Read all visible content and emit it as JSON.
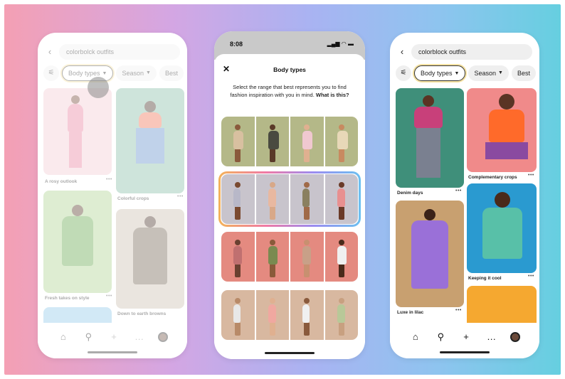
{
  "colors": {
    "bg_left": "#f4a0b4",
    "bg_right": "#66cfe0",
    "chip_glow": "#f3e0a0"
  },
  "left_phone": {
    "search": "colorbolck outfits",
    "chips": [
      "Body types",
      "Season",
      "Best"
    ],
    "captions": [
      "A rosy outlook",
      "Colorful crops",
      "Fresh takes on style",
      "Down to earth browns"
    ],
    "tabs": [
      "home-icon",
      "search-icon",
      "plus-icon",
      "chat-icon",
      "avatar"
    ]
  },
  "middle_phone": {
    "time": "8:08",
    "status_icons": "▂▄▆ ◠ ▬",
    "title": "Body types",
    "prompt_a": "Select the range that best represents you to find fashion inspiration with you in mind.",
    "prompt_link": "What is this?",
    "rows": [
      {
        "bg": "#b4b888",
        "skin": [
          "#8a5a3c",
          "#5a3a28",
          "#e0b090",
          "#c88a60"
        ],
        "cloth": [
          "#d8c0a0",
          "#4a4a40",
          "#f0c8d0",
          "#e8d8b8"
        ]
      },
      {
        "bg": "#c8c4cc",
        "skin": [
          "#7a4a30",
          "#d8a888",
          "#a06a48",
          "#6a3a28"
        ],
        "cloth": [
          "#b8b8c8",
          "#e8b8a0",
          "#8a8060",
          "#e89090"
        ]
      },
      {
        "bg": "#e48a80",
        "skin": [
          "#6a4030",
          "#8a5a3a",
          "#c89070",
          "#4a2a1a"
        ],
        "cloth": [
          "#c07070",
          "#7a8a50",
          "#c8a088",
          "#f0f0f0"
        ]
      },
      {
        "bg": "#d8b8a0",
        "skin": [
          "#b88a68",
          "#e0b090",
          "#8a5a3c",
          "#c8a080"
        ],
        "cloth": [
          "#e8e8e8",
          "#f0a8a0",
          "#f0f0f0",
          "#b8c898"
        ]
      }
    ]
  },
  "right_phone": {
    "search": "colorblock outfits",
    "chips": [
      "Body types",
      "Season",
      "Best"
    ],
    "captions": [
      "Denim days",
      "Complementary crops",
      "Keeping it cool",
      "Luxe in lilac"
    ],
    "tabs": [
      "home-icon",
      "search-icon",
      "plus-icon",
      "chat-icon",
      "avatar"
    ]
  }
}
